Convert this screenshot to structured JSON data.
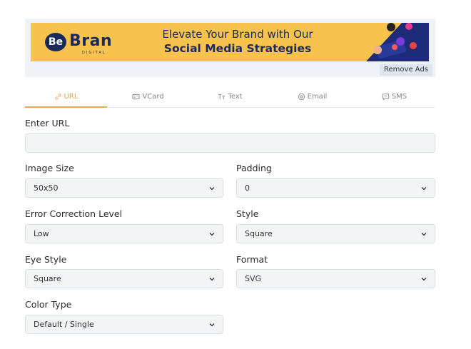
{
  "ad": {
    "logo_mark": "Be",
    "logo_text": "Bran",
    "logo_sub": "DIGITAL",
    "headline_line1": "Elevate Your Brand with Our",
    "headline_line2": "Social Media Strategies",
    "remove_label": "Remove Ads"
  },
  "tabs": [
    {
      "label": "URL",
      "icon": "link-icon",
      "active": true
    },
    {
      "label": "VCard",
      "icon": "id-card-icon",
      "active": false
    },
    {
      "label": "Text",
      "icon": "text-icon",
      "active": false
    },
    {
      "label": "Email",
      "icon": "email-icon",
      "active": false
    },
    {
      "label": "SMS",
      "icon": "chat-icon",
      "active": false
    }
  ],
  "form": {
    "url_label": "Enter URL",
    "url_value": "",
    "image_size_label": "Image Size",
    "image_size_value": "50x50",
    "padding_label": "Padding",
    "padding_value": "0",
    "error_label": "Error Correction Level",
    "error_value": "Low",
    "style_label": "Style",
    "style_value": "Square",
    "eye_label": "Eye Style",
    "eye_value": "Square",
    "format_label": "Format",
    "format_value": "SVG",
    "color_label": "Color Type",
    "color_value": "Default / Single"
  },
  "colors": {
    "accent": "#f0a44b",
    "banner_bg": "#f7c34c",
    "brand_navy": "#1a2a5a"
  }
}
